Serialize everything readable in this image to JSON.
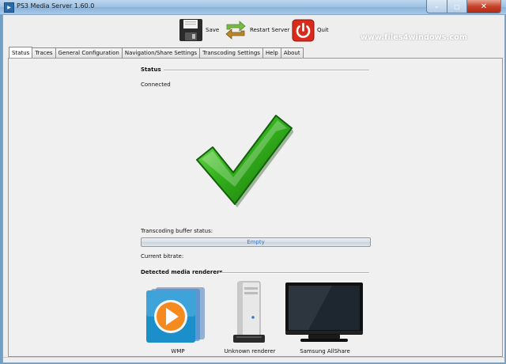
{
  "window": {
    "title": "PS3 Media Server 1.60.0",
    "minimize": "–",
    "maximize": "□",
    "close": "✕"
  },
  "toolbar": {
    "save_label": "Save",
    "restart_label": "Restart Server",
    "quit_label": "Quit"
  },
  "watermark": "www.files4windows.com",
  "tabs": [
    "Status",
    "Traces",
    "General Configuration",
    "Navigation/Share Settings",
    "Transcoding Settings",
    "Help",
    "About"
  ],
  "active_tab": "Status",
  "status": {
    "section_title": "Status",
    "connection": "Connected",
    "buffer_label": "Transcoding buffer status:",
    "buffer_text": "Empty",
    "buffer_fill": 0,
    "bitrate_label": "Current bitrate:"
  },
  "renderers": {
    "section_title": "Detected media renderers",
    "items": [
      {
        "name": "WMP",
        "icon": "wmp-icon"
      },
      {
        "name": "Unknown renderer",
        "icon": "pc-tower-icon"
      },
      {
        "name": "Samsung AllShare",
        "icon": "tv-icon"
      }
    ]
  },
  "colors": {
    "check": "#2fae18",
    "quit": "#d92b1c",
    "accent": "#3a7ac6"
  }
}
